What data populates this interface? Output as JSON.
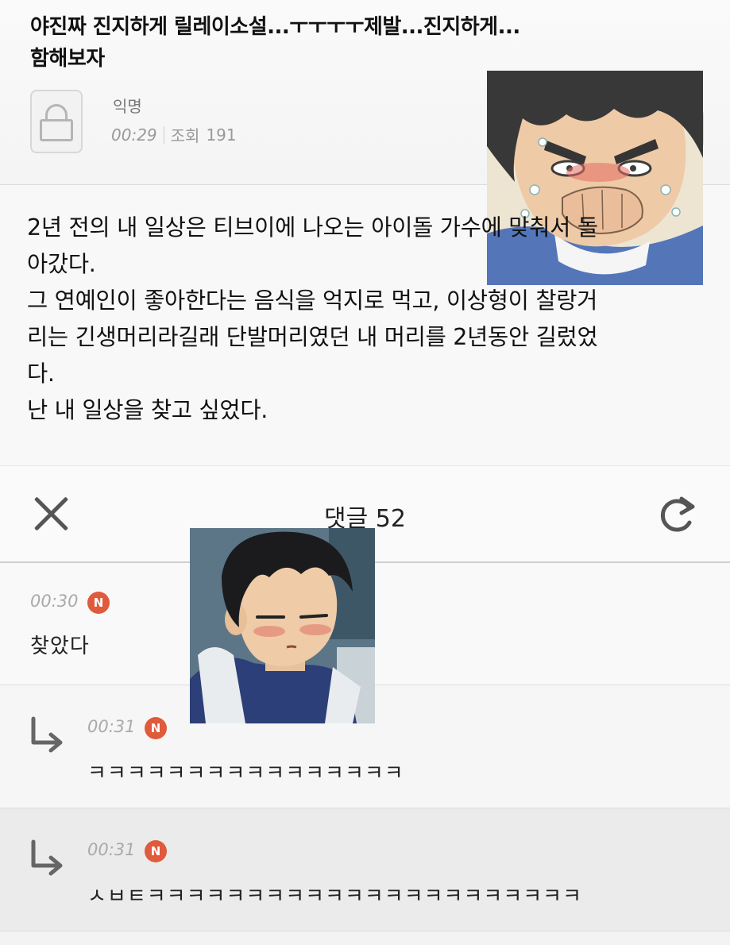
{
  "post": {
    "title": "야진짜 진지하게 릴레이소설...ㅜㅜㅜㅜ제발...진지하게...\n함해보자",
    "author": "익명",
    "time": "00:29",
    "views_label": "조회",
    "views": "191",
    "comment_count": "52",
    "body": [
      "2년 전의 내 일상은 티브이에 나오는 아이돌 가수에 맞춰서 돌",
      "아갔다.",
      "그 연예인이 좋아한다는 음식을 억지로 먹고, 이상형이 찰랑거",
      "리는 긴생머리라길래 단발머리였던 내 머리를 2년동안 길렀었",
      "다.",
      "난 내 일상을 찾고 싶었다."
    ]
  },
  "comments_header": {
    "title": "댓글 52"
  },
  "comments": [
    {
      "time": "00:30",
      "badge": "N",
      "text": "찾았다",
      "reply": false
    },
    {
      "time": "00:31",
      "badge": "N",
      "text": "ㅋㅋㅋㅋㅋㅋㅋㅋㅋㅋㅋㅋㅋㅋㅋㅋ",
      "reply": true
    },
    {
      "time": "00:31",
      "badge": "N",
      "text": "ㅅㅂㅌㅋㅋㅋㅋㅋㅋㅋㅋㅋㅋㅋㅋㅋㅋㅋㅋㅋㅋㅋㅋㅋㅋ",
      "reply": true
    }
  ],
  "icons": {
    "author_avatar": "lock-icon",
    "comment_bubble": "speech-bubble-icon",
    "close": "close-icon",
    "refresh": "refresh-icon",
    "reply": "reply-arrow-icon"
  },
  "colors": {
    "badge": "#e05a3c",
    "muted_text": "#999999"
  }
}
